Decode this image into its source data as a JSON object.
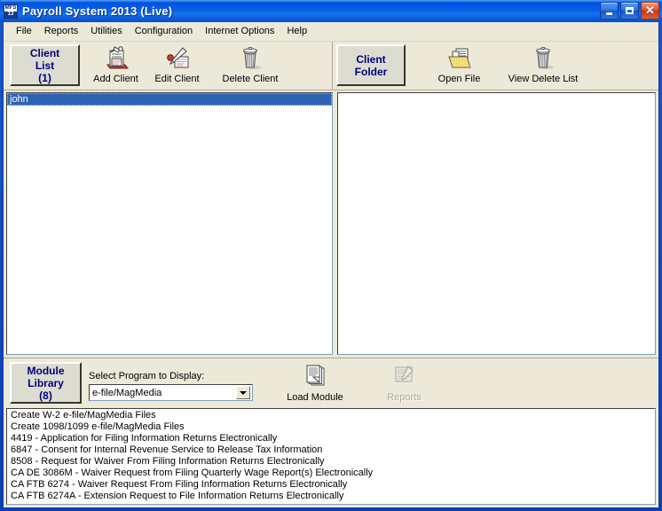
{
  "window": {
    "title": "Payroll System 2013 (Live)",
    "icon_top_text": "MFS",
    "icon_bottom_text": "13",
    "controls": {
      "minimize": "_",
      "maximize": "□",
      "close": "✕"
    },
    "colors": {
      "titlebar_blue": "#0a5ae2",
      "face": "#ece9d8",
      "selection_blue": "#2f63b5",
      "tab_text_navy": "#000080"
    }
  },
  "menu": {
    "items": [
      {
        "label": "File"
      },
      {
        "label": "Reports"
      },
      {
        "label": "Utilities"
      },
      {
        "label": "Configuration"
      },
      {
        "label": "Internet Options"
      },
      {
        "label": "Help"
      }
    ]
  },
  "toolbar": {
    "client_list_tab": {
      "line1": "Client",
      "line2": "List",
      "line3": "(1)"
    },
    "client_folder_tab": {
      "line1": "Client",
      "line2": "Folder"
    },
    "left_buttons": [
      {
        "label": "Add Client",
        "icon": "add-client-icon",
        "disabled": false
      },
      {
        "label": "Edit Client",
        "icon": "edit-client-icon",
        "disabled": false
      },
      {
        "label": "Delete Client",
        "icon": "delete-client-icon",
        "disabled": false
      }
    ],
    "right_buttons": [
      {
        "label": "Open File",
        "icon": "open-file-icon",
        "disabled": false
      },
      {
        "label": "View Delete List",
        "icon": "trash-icon",
        "disabled": false
      }
    ]
  },
  "client_list": {
    "rows": [
      {
        "name": "john",
        "selected": true
      }
    ]
  },
  "client_folder": {
    "rows": []
  },
  "module_library": {
    "tab": {
      "line1": "Module",
      "line2": "Library",
      "line3": "(8)"
    },
    "select_label": "Select Program to Display:",
    "selected_program": "e-file/MagMedia",
    "options": [
      "e-file/MagMedia"
    ],
    "load_module_button": {
      "label": "Load Module",
      "icon": "load-module-icon",
      "disabled": false
    },
    "reports_button": {
      "label": "Reports",
      "icon": "reports-icon",
      "disabled": true
    },
    "programs": [
      "Create W-2 e-file/MagMedia Files",
      "Create 1098/1099 e-file/MagMedia Files",
      "4419 - Application for Filing Information Returns Electronically",
      "6847 - Consent for Internal Revenue Service to Release Tax Information",
      "8508 - Request for Waiver From Filing Information Returns Electronically",
      "CA DE 3086M - Waiver Request from Filing Quarterly Wage Report(s) Electronically",
      "CA FTB 6274 - Waiver Request From Filing Information Returns Electronically",
      "CA FTB 6274A - Extension Request to File Information Returns Electronically"
    ]
  }
}
